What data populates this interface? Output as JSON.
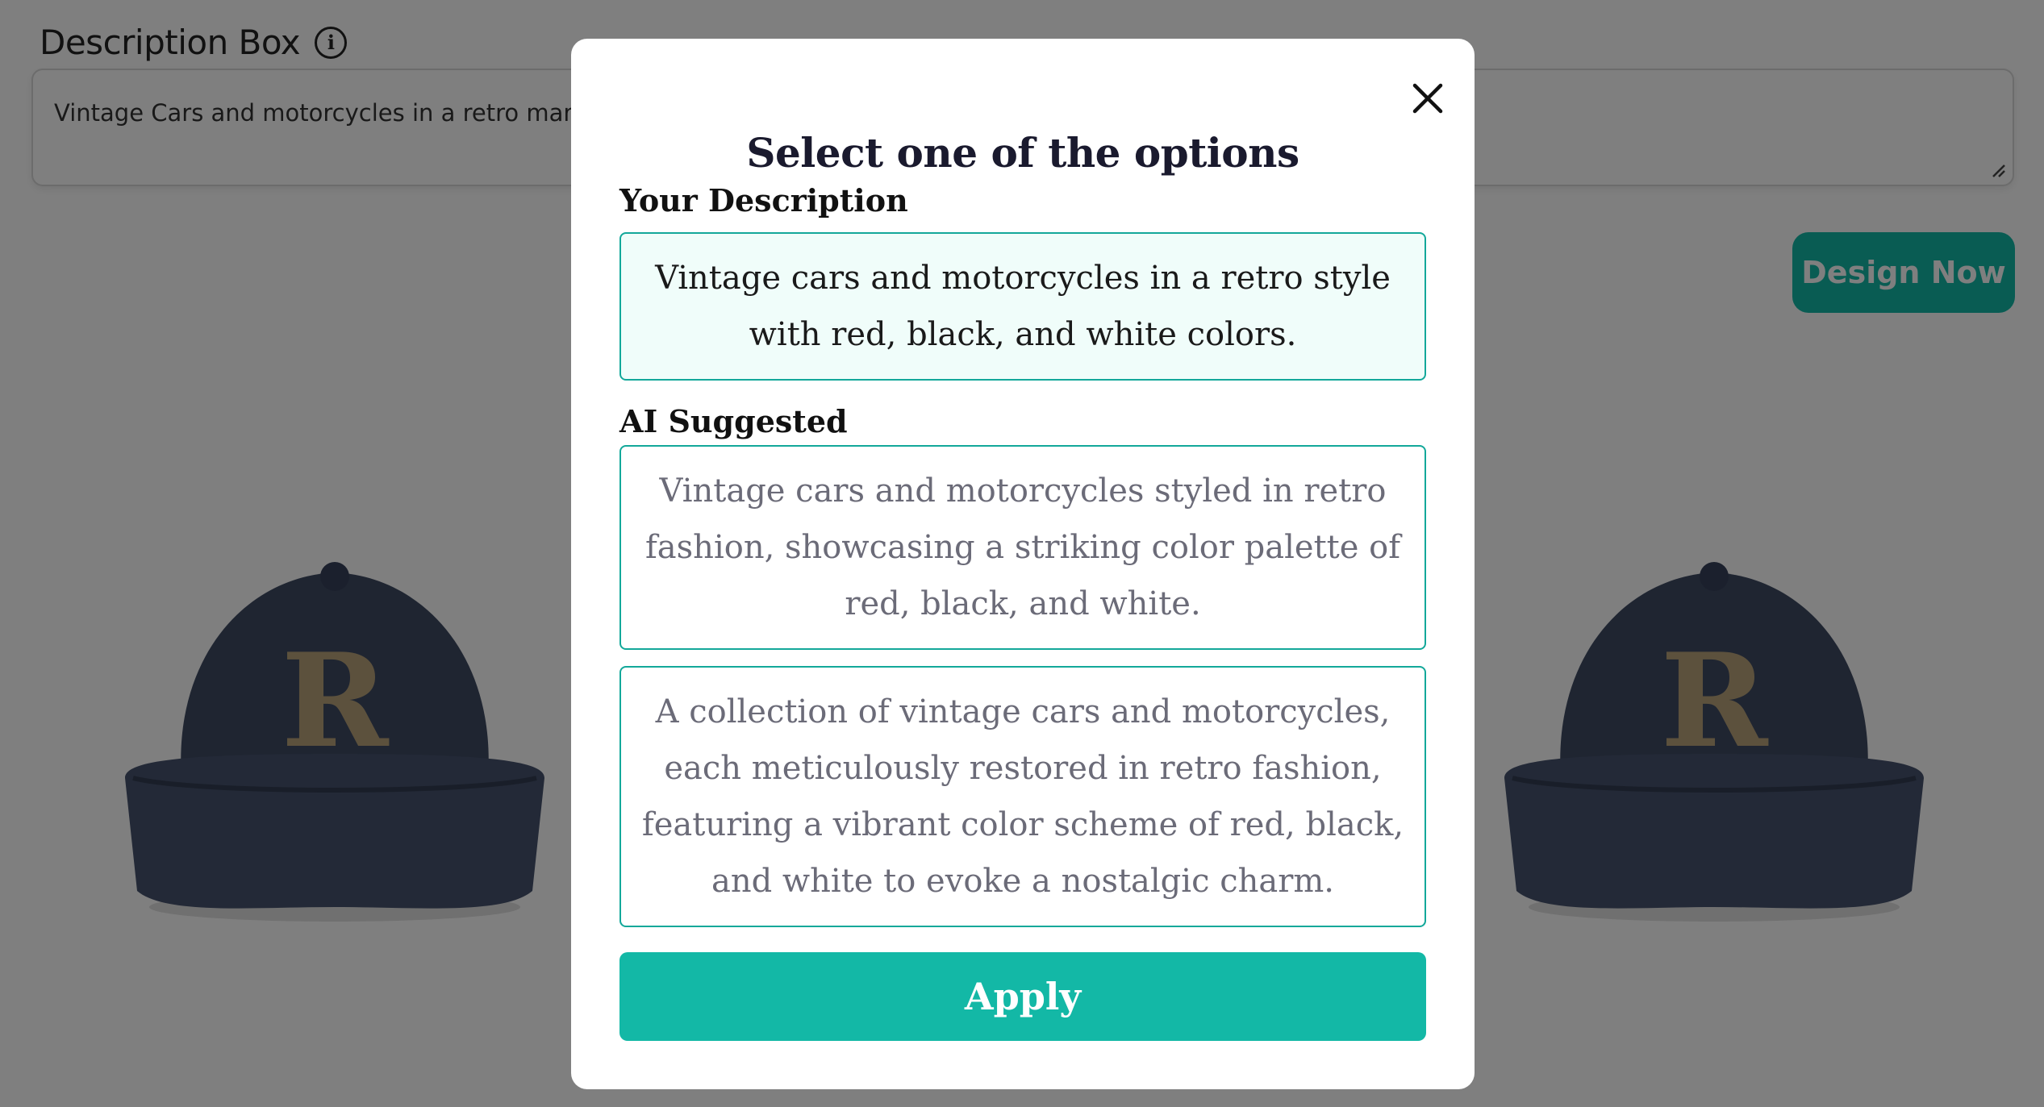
{
  "page": {
    "description_label": "Description Box",
    "description_value": "Vintage Cars and motorcycles in a retro manner with red, black, and white colors.",
    "design_button_label": "Design Now",
    "cap_logo_letter": "R"
  },
  "modal": {
    "title": "Select one of the options",
    "your_description_label": "Your Description",
    "your_description_text": "Vintage cars and motorcycles in a retro style with red, black, and white colors.",
    "ai_suggested_label": "AI Suggested",
    "ai_options": [
      {
        "text": "Vintage cars and motorcycles styled in retro fashion, showcasing a striking color palette of red, black, and white."
      },
      {
        "text": "A collection of vintage cars and motorcycles, each meticulously restored in retro fashion, featuring a vibrant color scheme of red, black, and white to evoke a nostalgic charm."
      }
    ],
    "apply_label": "Apply"
  },
  "icons": {
    "info": "info-icon",
    "close": "close-icon",
    "resize": "resize-handle-icon"
  },
  "colors": {
    "accent": "#13b8a6",
    "border_accent": "#13a89a",
    "selected_bg": "#f0fdfa",
    "overlay": "rgba(0,0,0,0.5)"
  }
}
